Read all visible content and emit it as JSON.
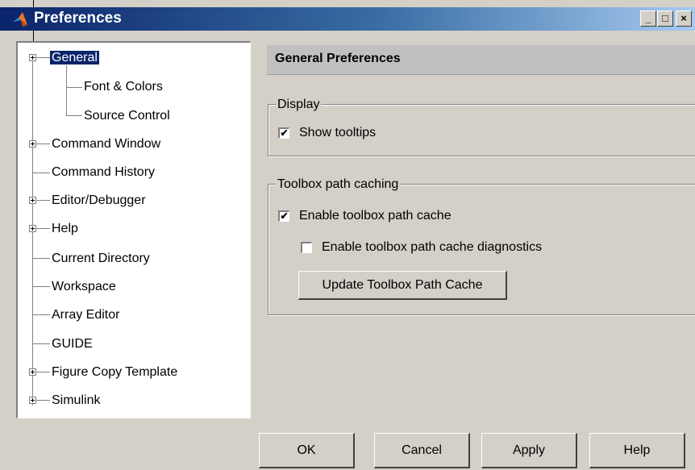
{
  "window": {
    "title": "Preferences",
    "controls": {
      "minimize": "_",
      "maximize": "□",
      "close": "×"
    }
  },
  "tree": {
    "items": [
      {
        "label": "General",
        "expandable": true,
        "selected": true
      },
      {
        "label": "Font & Colors",
        "expandable": false
      },
      {
        "label": "Source Control",
        "expandable": false
      },
      {
        "label": "Command Window",
        "expandable": true
      },
      {
        "label": "Command History",
        "expandable": false
      },
      {
        "label": "Editor/Debugger",
        "expandable": true
      },
      {
        "label": "Help",
        "expandable": true
      },
      {
        "label": "Current Directory",
        "expandable": false
      },
      {
        "label": "Workspace",
        "expandable": false
      },
      {
        "label": "Array Editor",
        "expandable": false
      },
      {
        "label": "GUIDE",
        "expandable": false
      },
      {
        "label": "Figure Copy Template",
        "expandable": true
      },
      {
        "label": "Simulink",
        "expandable": true
      }
    ]
  },
  "panel": {
    "header": "General Preferences",
    "display_group": {
      "legend": "Display",
      "show_tooltips": {
        "label": "Show tooltips",
        "checked": true
      }
    },
    "toolbox_group": {
      "legend": "Toolbox path caching",
      "enable_cache": {
        "label": "Enable toolbox path cache",
        "checked": true
      },
      "enable_diagnostics": {
        "label": "Enable toolbox path cache diagnostics",
        "checked": false
      },
      "update_button": "Update Toolbox Path Cache"
    }
  },
  "buttons": {
    "ok": "OK",
    "cancel": "Cancel",
    "apply": "Apply",
    "help": "Help"
  }
}
